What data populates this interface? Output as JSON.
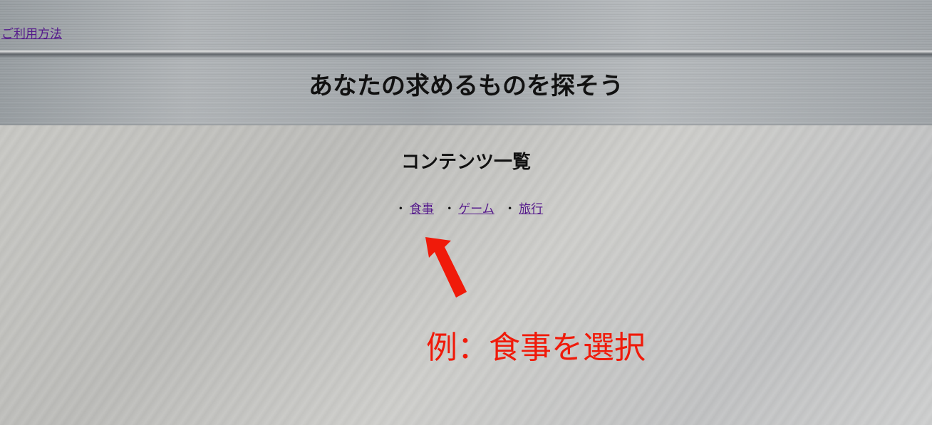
{
  "header": {
    "usage_link": "ご利用方法",
    "title": "あなたの求めるものを探そう"
  },
  "main": {
    "heading": "コンテンツ一覧",
    "bullet": "・",
    "items": [
      {
        "label": "食事"
      },
      {
        "label": "ゲーム"
      },
      {
        "label": "旅行"
      }
    ]
  },
  "annotation": {
    "text": "例：食事を選択",
    "color": "#f01a0a"
  }
}
